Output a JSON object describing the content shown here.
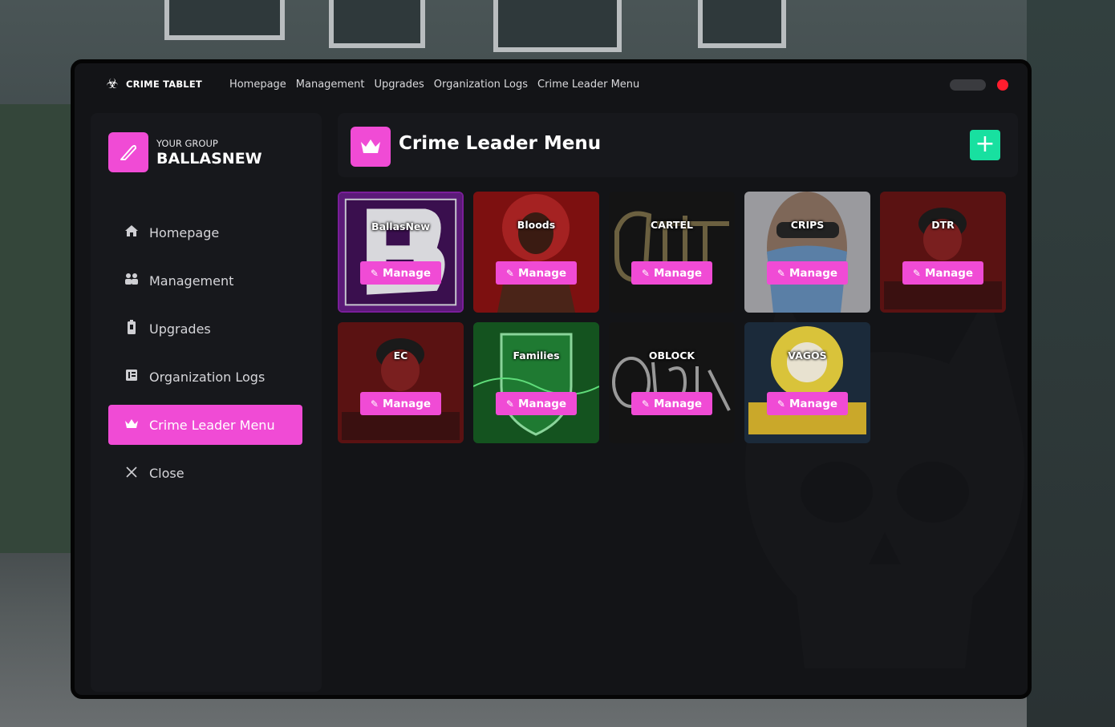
{
  "app": {
    "brand": "CRIME TABLET"
  },
  "topnav": [
    "Homepage",
    "Management",
    "Upgrades",
    "Organization Logs",
    "Crime Leader Menu"
  ],
  "group": {
    "label": "YOUR GROUP",
    "name": "BALLASNEW"
  },
  "sidebar": {
    "items": [
      {
        "label": "Homepage",
        "icon": "home-icon"
      },
      {
        "label": "Management",
        "icon": "users-icon"
      },
      {
        "label": "Upgrades",
        "icon": "battery-icon"
      },
      {
        "label": "Organization Logs",
        "icon": "logs-icon"
      },
      {
        "label": "Crime Leader Menu",
        "icon": "crown-icon",
        "active": true
      },
      {
        "label": "Close",
        "icon": "close-icon"
      }
    ]
  },
  "header": {
    "title": "Crime Leader Menu"
  },
  "manage_label": "Manage",
  "organizations": [
    {
      "name": "BallasNew",
      "selected": true
    },
    {
      "name": "Bloods"
    },
    {
      "name": "CARTEL"
    },
    {
      "name": "CRIPS"
    },
    {
      "name": "DTR"
    },
    {
      "name": "EC"
    },
    {
      "name": "Families"
    },
    {
      "name": "OBLOCK"
    },
    {
      "name": "VAGOS"
    }
  ],
  "colors": {
    "accent": "#f04bd5",
    "add": "#18e0a0",
    "close_dot": "#ff1d2e",
    "panel": "#17181c",
    "tablet": "#131417"
  }
}
